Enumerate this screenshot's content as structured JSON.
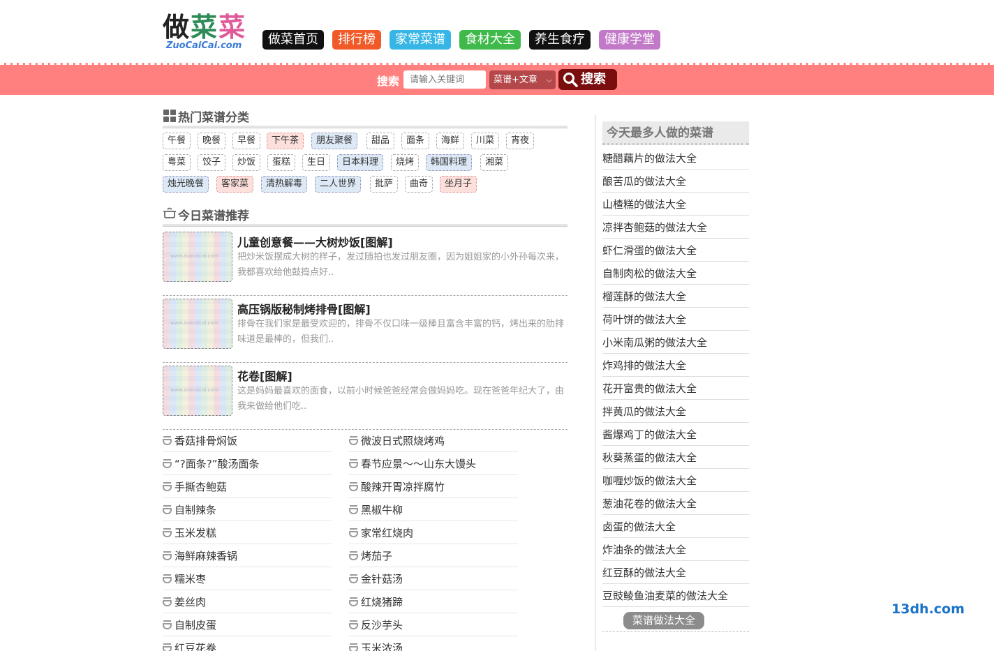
{
  "logo": {
    "chars": [
      "做",
      "菜",
      "菜"
    ],
    "domain": "ZuoCaiCai.com"
  },
  "nav": [
    {
      "label": "做菜首页",
      "color": "#111111"
    },
    {
      "label": "排行榜",
      "color": "#f05a28"
    },
    {
      "label": "家常菜谱",
      "color": "#37b6e6"
    },
    {
      "label": "食材大全",
      "color": "#3fb94a"
    },
    {
      "label": "养生食疗",
      "color": "#111111"
    },
    {
      "label": "健康学堂",
      "color": "#c27ac8"
    }
  ],
  "search": {
    "label": "搜索",
    "placeholder": "请输入关键词",
    "select_value": "菜谱+文章",
    "button_label": "搜索"
  },
  "hot_categories": {
    "title": "热门菜谱分类",
    "tags": [
      {
        "label": "午餐",
        "style": "plain"
      },
      {
        "label": "晚餐",
        "style": "plain"
      },
      {
        "label": "早餐",
        "style": "plain"
      },
      {
        "label": "下午茶",
        "style": "red"
      },
      {
        "label": "朋友聚餐",
        "style": "blue"
      },
      {
        "label": "甜品",
        "style": "plain"
      },
      {
        "label": "面条",
        "style": "plain"
      },
      {
        "label": "海鲜",
        "style": "plain"
      },
      {
        "label": "川菜",
        "style": "plain"
      },
      {
        "label": "宵夜",
        "style": "plain"
      },
      {
        "label": "粤菜",
        "style": "plain"
      },
      {
        "label": "饺子",
        "style": "plain"
      },
      {
        "label": "炒饭",
        "style": "plain"
      },
      {
        "label": "蛋糕",
        "style": "plain"
      },
      {
        "label": "生日",
        "style": "plain"
      },
      {
        "label": "日本料理",
        "style": "blue"
      },
      {
        "label": "烧烤",
        "style": "plain"
      },
      {
        "label": "韩国料理",
        "style": "blue"
      },
      {
        "label": "湘菜",
        "style": "plain"
      },
      {
        "label": "烛光晚餐",
        "style": "blue"
      },
      {
        "label": "客家菜",
        "style": "red"
      },
      {
        "label": "清热解毒",
        "style": "blue"
      },
      {
        "label": "二人世界",
        "style": "blue"
      },
      {
        "label": "批萨",
        "style": "plain"
      },
      {
        "label": "曲奇",
        "style": "plain"
      },
      {
        "label": "坐月子",
        "style": "red"
      }
    ]
  },
  "today": {
    "title": "今日菜谱推荐",
    "items": [
      {
        "title": "儿童创意餐——大树炒饭[图解]",
        "desc": "把炒米饭摆成大树的样子，发过随拍也发过朋友圈，因为姐姐家的小外孙每次来，我都喜欢给他鼓捣点好.."
      },
      {
        "title": "高压锅版秘制烤排骨[图解]",
        "desc": "排骨在我们家是最受欢迎的，排骨不仅口味一级棒且富含丰富的钙，烤出来的肋排味道是最棒的，但我们.."
      },
      {
        "title": "花卷[图解]",
        "desc": "这是妈妈最喜欢的面食，以前小时候爸爸经常会做妈妈吃。现在爸爸年纪大了，由我来做给他们吃.."
      }
    ],
    "thumb_watermark": "www.zuocaicai.com"
  },
  "left_list_a": [
    "香菇排骨焖饭",
    "“?面条?”酸汤面条",
    "手撕杏鲍菇",
    "自制辣条",
    "玉米发糕",
    "海鲜麻辣香锅",
    "糯米枣",
    "姜丝肉",
    "自制皮蛋",
    "红豆花卷"
  ],
  "left_list_b": [
    "微波日式照烧烤鸡",
    "春节应景～～山东大馒头",
    "酸辣开胃凉拌腐竹",
    "黑椒牛柳",
    "家常红烧肉",
    "烤茄子",
    "金针菇汤",
    "红烧猪蹄",
    "反沙芋头",
    "玉米浓汤"
  ],
  "right": {
    "title": "今天最多人做的菜谱",
    "items": [
      "糖醋藕片的做法大全",
      "酿苦瓜的做法大全",
      "山楂糕的做法大全",
      "凉拌杏鲍菇的做法大全",
      "虾仁滑蛋的做法大全",
      "自制肉松的做法大全",
      "榴莲酥的做法大全",
      "荷叶饼的做法大全",
      "小米南瓜粥的做法大全",
      "炸鸡排的做法大全",
      "花开富贵的做法大全",
      "拌黄瓜的做法大全",
      "酱爆鸡丁的做法大全",
      "秋葵蒸蛋的做法大全",
      "咖喱炒饭的做法大全",
      "葱油花卷的做法大全",
      "卤蛋的做法大全",
      "炸油条的做法大全",
      "红豆酥的做法大全",
      "豆豉鲮鱼油麦菜的做法大全"
    ],
    "more_label": "菜谱做法大全"
  },
  "watermark": "13dh.com"
}
